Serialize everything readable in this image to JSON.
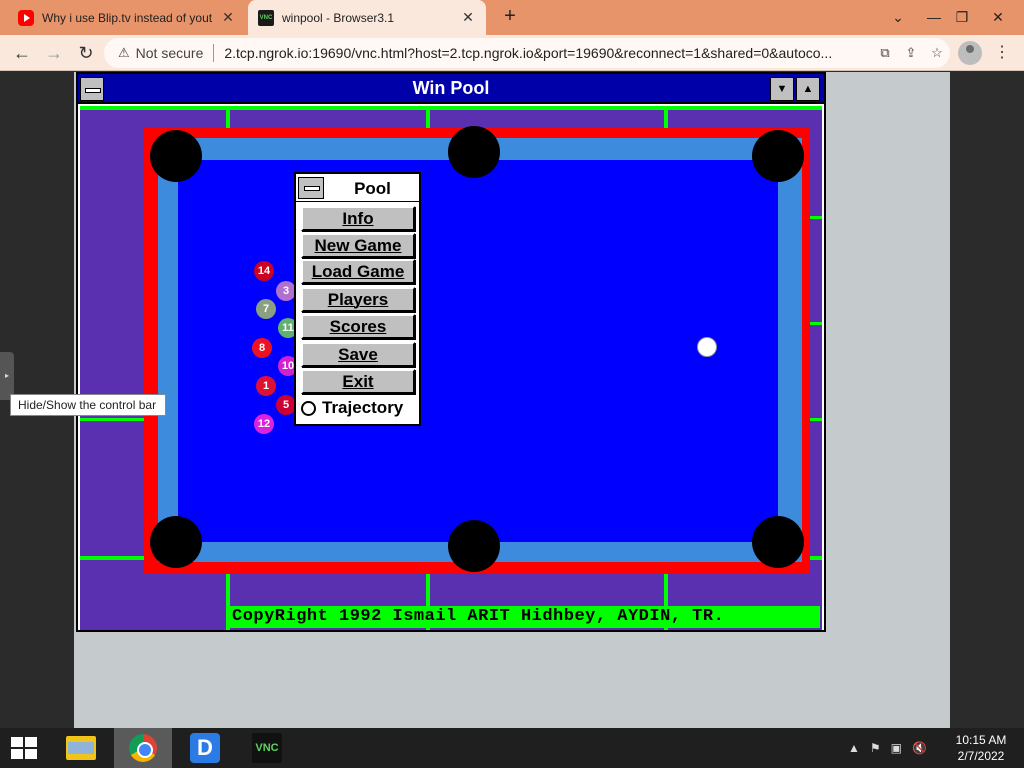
{
  "browser": {
    "tabs": [
      {
        "title": "Why i use Blip.tv instead of yout",
        "favicon": "youtube-icon"
      },
      {
        "title": "winpool - Browser3.1",
        "favicon": "vnc-icon"
      }
    ],
    "new_tab": "+",
    "window_controls": {
      "collapse": "⌄",
      "minimize": "—",
      "restore": "❐",
      "close": "✕"
    },
    "nav": {
      "back": "←",
      "forward": "→",
      "reload": "↻"
    },
    "security_label": "Not secure",
    "url": "2.tcp.ngrok.io:19690/vnc.html?host=2.tcp.ngrok.io&port=19690&reconnect=1&shared=0&autoco..."
  },
  "vnc": {
    "tooltip": "Hide/Show the control bar"
  },
  "winpool": {
    "title": "Win Pool",
    "copyright": "CopyRight 1992 Ismail ARIT Hidhbey, AYDIN, TR.",
    "colors": {
      "title_bar": "#0000a8",
      "felt": "#0000ff",
      "rail": "#ff0000",
      "cushion": "#3c8bdc",
      "frame": "#5a2fb0",
      "accent": "#00ff00"
    },
    "balls": [
      {
        "number": "14",
        "color": "#cc0022"
      },
      {
        "number": "3",
        "color": "#b070d0"
      },
      {
        "number": "7",
        "color": "#8aa080"
      },
      {
        "number": "11",
        "color": "#60b070"
      },
      {
        "number": "8",
        "color": "#ee1122"
      },
      {
        "number": "10",
        "color": "#d020d0"
      },
      {
        "number": "1",
        "color": "#dd1133"
      },
      {
        "number": "5",
        "color": "#cc0033"
      },
      {
        "number": "12",
        "color": "#dd22dd"
      }
    ]
  },
  "pool_menu": {
    "title": "Pool",
    "buttons": [
      "Info",
      "New Game",
      "Load Game",
      "Players",
      "Scores",
      "Save",
      "Exit"
    ],
    "trajectory_label": "Trajectory"
  },
  "taskbar": {
    "items": [
      "windows-start",
      "file-explorer",
      "chrome",
      "remote-desktop",
      "vnc-viewer"
    ],
    "time": "10:15 AM",
    "date": "2/7/2022"
  }
}
